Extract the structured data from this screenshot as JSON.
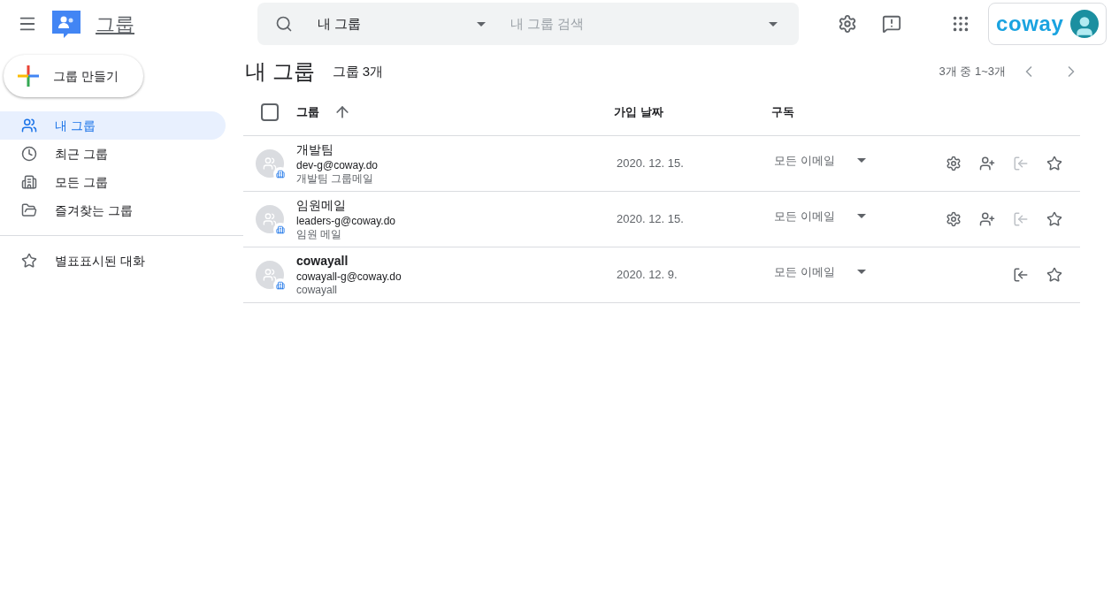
{
  "header": {
    "app_name": "그룹",
    "scope": "내 그룹",
    "search_placeholder": "내 그룹 검색",
    "logo_text": "coway"
  },
  "create_button": "그룹 만들기",
  "nav": [
    {
      "kind": "people",
      "label": "내 그룹",
      "selected": true
    },
    {
      "kind": "clock",
      "label": "최근 그룹",
      "selected": false
    },
    {
      "kind": "building",
      "label": "모든 그룹",
      "selected": false
    },
    {
      "kind": "folder",
      "label": "즐겨찾는 그룹",
      "selected": false
    },
    {
      "kind": "divider"
    },
    {
      "kind": "star",
      "label": "별표표시된 대화",
      "selected": false
    }
  ],
  "page": {
    "title": "내 그룹",
    "count": "그룹 3개",
    "pagination": "3개 중 1~3개"
  },
  "table": {
    "columns": [
      "그룹",
      "가입 날짜",
      "구독"
    ],
    "select_all": {
      "checked": false
    },
    "rows": [
      {
        "name": "개발팀",
        "unread": false,
        "email": "dev-g@coway.do",
        "description": "개발팀 그룹메일",
        "joined": "2020. 12. 15.",
        "subscription": "모든 이메일",
        "manager": true,
        "leave_disabled": true
      },
      {
        "name": "임원메일",
        "unread": false,
        "email": "leaders-g@coway.do",
        "description": "임원 메일",
        "joined": "2020. 12. 15.",
        "subscription": "모든 이메일",
        "manager": true,
        "leave_disabled": true
      },
      {
        "name": "cowayall",
        "unread": true,
        "email": "cowayall-g@coway.do",
        "description": "cowayall",
        "joined": "2020. 12. 9.",
        "subscription": "모든 이메일",
        "manager": false,
        "leave_disabled": false
      }
    ]
  }
}
